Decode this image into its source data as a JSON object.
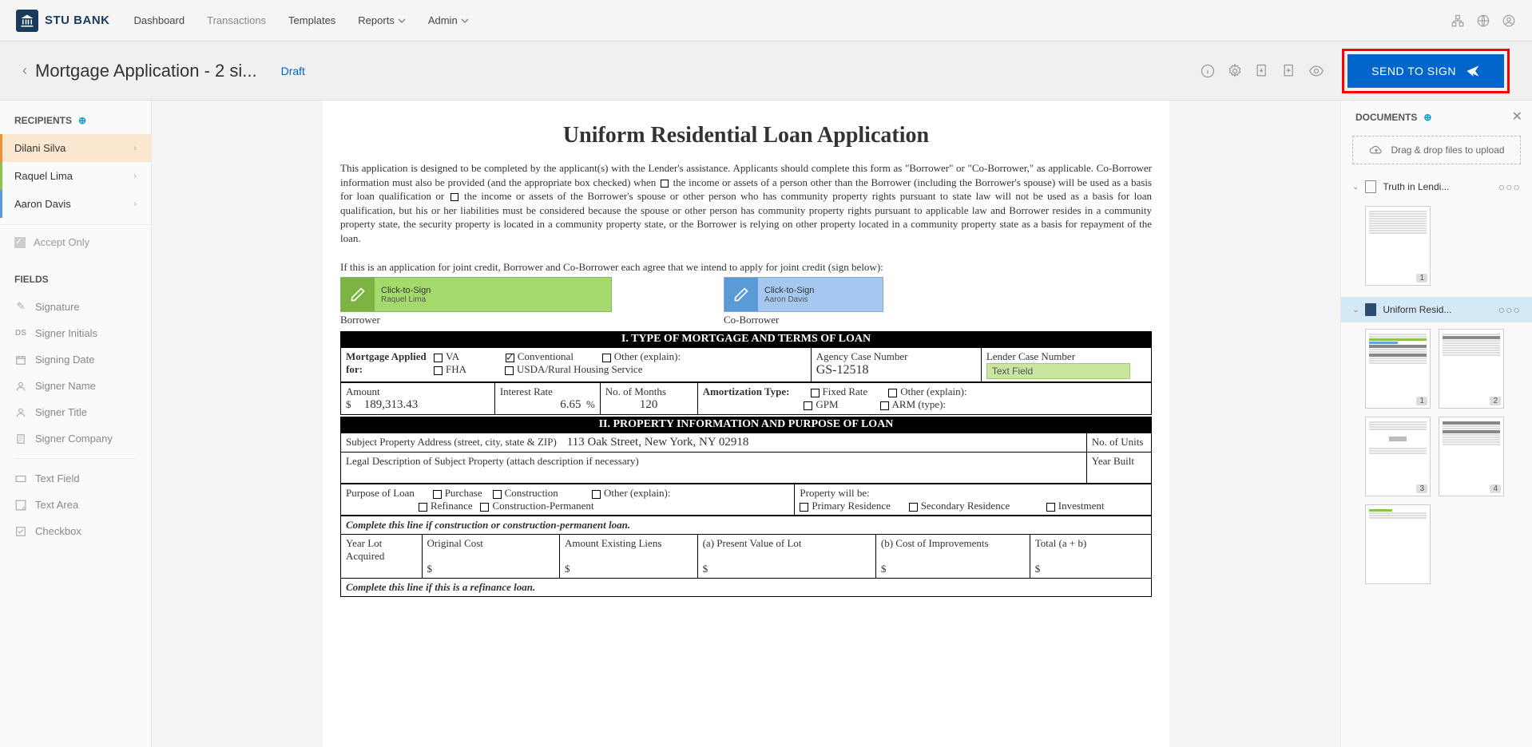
{
  "brand": {
    "name": "STU BANK"
  },
  "nav": {
    "items": [
      "Dashboard",
      "Transactions",
      "Templates",
      "Reports",
      "Admin"
    ]
  },
  "page": {
    "title": "Mortgage Application - 2 si...",
    "status": "Draft",
    "send_button": "SEND TO SIGN"
  },
  "recipients": {
    "title": "RECIPIENTS",
    "items": [
      {
        "name": "Dilani Silva"
      },
      {
        "name": "Raquel Lima"
      },
      {
        "name": "Aaron Davis"
      }
    ],
    "accept_only": "Accept Only"
  },
  "fields": {
    "title": "FIELDS",
    "items": [
      {
        "icon": "pen",
        "label": "Signature"
      },
      {
        "icon": "ds",
        "label": "Signer Initials"
      },
      {
        "icon": "cal",
        "label": "Signing Date"
      },
      {
        "icon": "person",
        "label": "Signer Name"
      },
      {
        "icon": "person",
        "label": "Signer Title"
      },
      {
        "icon": "building",
        "label": "Signer Company"
      },
      {
        "icon": "tf",
        "label": "Text Field"
      },
      {
        "icon": "ta",
        "label": "Text Area"
      },
      {
        "icon": "cb",
        "label": "Checkbox"
      }
    ]
  },
  "document": {
    "title": "Uniform Residential Loan Application",
    "intro_part1": "This application is designed to be completed by the applicant(s) with the Lender's assistance. Applicants should complete this form as \"Borrower\" or \"Co-Borrower,\" as applicable. Co-Borrower information must also be provided (and the appropriate box checked) when ",
    "intro_part2": " the income or assets of a person other than the Borrower (including the Borrower's spouse) will be used as a basis for loan qualification or ",
    "intro_part3": " the income or assets of the Borrower's spouse or other person who has community property rights pursuant to state law will not be used as a basis for loan qualification, but his or her liabilities must be considered because the spouse or other person has community property rights pursuant to applicable law and Borrower resides in a community property state, the security property is located in a community property state, or the Borrower is relying on other property located in a community property state as a basis for repayment of the loan.",
    "joint_credit": "If this is an application for joint credit, Borrower and Co-Borrower each agree that we intend to apply for joint credit (sign below):",
    "sign1": {
      "label": "Click-to-Sign",
      "name": "Raquel Lima",
      "caption": "Borrower"
    },
    "sign2": {
      "label": "Click-to-Sign",
      "name": "Aaron Davis",
      "caption": "Co-Borrower"
    },
    "section1": "I. TYPE OF MORTGAGE AND TERMS OF LOAN",
    "mortgage_label": "Mortgage Applied for:",
    "mortgage_opts": {
      "va": "VA",
      "conventional": "Conventional",
      "other": "Other (explain):",
      "fha": "FHA",
      "usda": "USDA/Rural Housing Service"
    },
    "agency_label": "Agency Case Number",
    "agency_value": "GS-12518",
    "lender_label": "Lender Case Number",
    "lender_placeholder": "Text Field",
    "amount_label": "Amount",
    "amount_currency": "$",
    "amount_value": "189,313.43",
    "rate_label": "Interest Rate",
    "rate_value": "6.65",
    "rate_unit": "%",
    "months_label": "No. of Months",
    "months_value": "120",
    "amort_label": "Amortization Type:",
    "amort_opts": {
      "fixed": "Fixed Rate",
      "other": "Other (explain):",
      "gpm": "GPM",
      "arm": "ARM (type):"
    },
    "section2": "II. PROPERTY INFORMATION AND PURPOSE OF LOAN",
    "prop_addr_label": "Subject Property Address (street, city, state & ZIP)",
    "prop_addr_value": "113 Oak Street, New York, NY 02918",
    "units_label": "No. of Units",
    "legal_desc_label": "Legal Description of Subject Property (attach description if necessary)",
    "year_built_label": "Year Built",
    "purpose_label": "Purpose of Loan",
    "purpose_opts": {
      "purchase": "Purchase",
      "construction": "Construction",
      "other": "Other (explain):",
      "refinance": "Refinance",
      "constperm": "Construction-Permanent"
    },
    "propwill_label": "Property will be:",
    "propwill_opts": {
      "primary": "Primary Residence",
      "secondary": "Secondary Residence",
      "investment": "Investment"
    },
    "construction_line": "Complete this line if construction or construction-permanent loan.",
    "cons_cols": {
      "yearlot": "Year Lot Acquired",
      "origcost": "Original Cost",
      "existing": "Amount Existing Liens",
      "present": "(a) Present Value of Lot",
      "improve": "(b) Cost of Improvements",
      "total": "Total (a + b)"
    },
    "dollar": "$",
    "refinance_line": "Complete this line if this is a refinance loan."
  },
  "documents_panel": {
    "title": "DOCUMENTS",
    "drop_text": "Drag & drop files to upload",
    "docs": [
      {
        "name": "Truth in Lendi...",
        "pages": 1
      },
      {
        "name": "Uniform Resid...",
        "pages": 4
      }
    ]
  }
}
